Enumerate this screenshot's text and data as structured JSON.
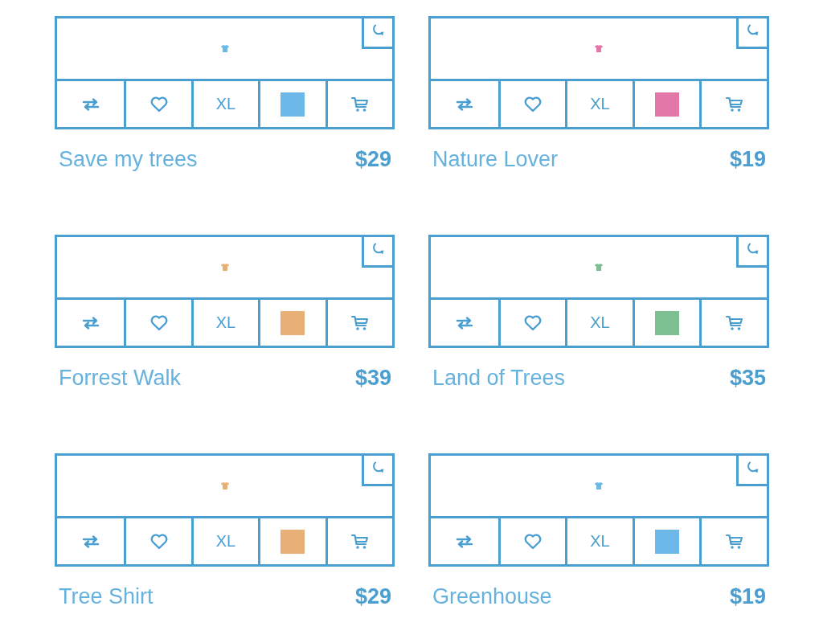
{
  "products": [
    {
      "name": "Save my trees",
      "price": "$29",
      "size": "XL",
      "color": "#6cb8e8"
    },
    {
      "name": "Nature Lover",
      "price": "$19",
      "size": "XL",
      "color": "#e277a8"
    },
    {
      "name": "Forrest Walk",
      "price": "$39",
      "size": "XL",
      "color": "#e8b077"
    },
    {
      "name": "Land of Trees",
      "price": "$35",
      "size": "XL",
      "color": "#7cc092"
    },
    {
      "name": "Tree Shirt",
      "price": "$29",
      "size": "XL",
      "color": "#e8b077"
    },
    {
      "name": "Greenhouse",
      "price": "$19",
      "size": "XL",
      "color": "#6cb8e8"
    }
  ]
}
